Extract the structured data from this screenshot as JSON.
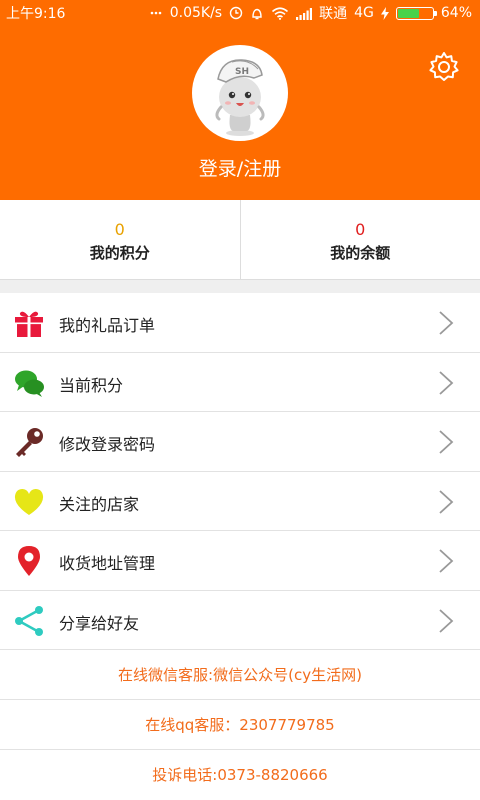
{
  "status_bar": {
    "time": "上午9:16",
    "speed": "0.05K/s",
    "carrier": "联通",
    "network": "4G",
    "battery": "64%",
    "battery_level": 0.64
  },
  "header": {
    "login_label": "登录/注册",
    "settings_icon": "gear-icon",
    "avatar_badge": "SH"
  },
  "stats": [
    {
      "value": "0",
      "label": "我的积分",
      "value_color": "#e8a100"
    },
    {
      "value": "0",
      "label": "我的余额",
      "value_color": "#e01e1e"
    }
  ],
  "menu": [
    {
      "label": "我的礼品订单",
      "icon": "gift-icon"
    },
    {
      "label": "当前积分",
      "icon": "chat-bubbles-icon"
    },
    {
      "label": "修改登录密码",
      "icon": "key-icon"
    },
    {
      "label": "关注的店家",
      "icon": "heart-icon"
    },
    {
      "label": "收货地址管理",
      "icon": "location-pin-icon"
    },
    {
      "label": "分享给好友",
      "icon": "share-icon"
    }
  ],
  "contact": {
    "wechat": "在线微信客服:微信公众号(cy生活网)",
    "qq": "在线qq客服：2307779785",
    "phone": "投诉电话:0373-8820666"
  },
  "colors": {
    "brand": "#fe6c00",
    "contact_text": "#f26c1c"
  }
}
